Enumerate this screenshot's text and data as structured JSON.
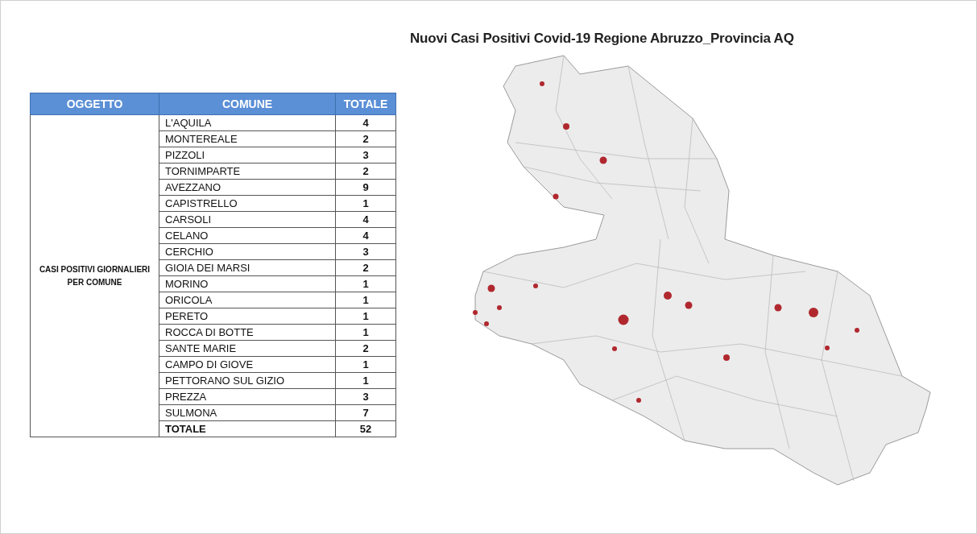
{
  "title": "Nuovi Casi Positivi Covid-19 Regione Abruzzo_Provincia AQ",
  "table": {
    "columns": [
      "OGGETTO",
      "COMUNE",
      "TOTALE"
    ],
    "group_label": "CASI POSITIVI GIORNALIERI PER COMUNE",
    "rows": [
      {
        "comune": "L'AQUILA",
        "totale": "4"
      },
      {
        "comune": "MONTEREALE",
        "totale": "2"
      },
      {
        "comune": "PIZZOLI",
        "totale": "3"
      },
      {
        "comune": "TORNIMPARTE",
        "totale": "2"
      },
      {
        "comune": "AVEZZANO",
        "totale": "9"
      },
      {
        "comune": "CAPISTRELLO",
        "totale": "1"
      },
      {
        "comune": "CARSOLI",
        "totale": "4"
      },
      {
        "comune": "CELANO",
        "totale": "4"
      },
      {
        "comune": "CERCHIO",
        "totale": "3"
      },
      {
        "comune": "GIOIA DEI MARSI",
        "totale": "2"
      },
      {
        "comune": "MORINO",
        "totale": "1"
      },
      {
        "comune": "ORICOLA",
        "totale": "1"
      },
      {
        "comune": "PERETO",
        "totale": "1"
      },
      {
        "comune": "ROCCA DI BOTTE",
        "totale": "1"
      },
      {
        "comune": "SANTE MARIE",
        "totale": "2"
      },
      {
        "comune": "CAMPO DI GIOVE",
        "totale": "1"
      },
      {
        "comune": "PETTORANO SUL GIZIO",
        "totale": "1"
      },
      {
        "comune": "PREZZA",
        "totale": "3"
      },
      {
        "comune": "SULMONA",
        "totale": "7"
      }
    ],
    "total_row": {
      "label": "TOTALE",
      "value": "52"
    }
  }
}
